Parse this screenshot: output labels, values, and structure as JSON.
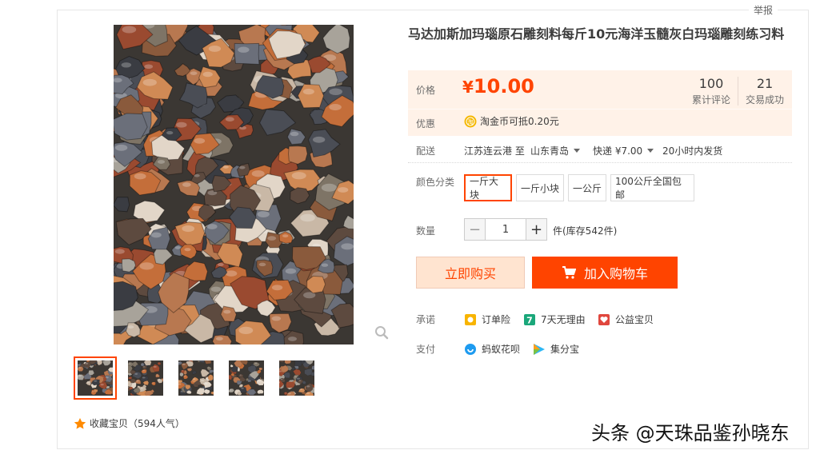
{
  "report": "举报",
  "title": "马达加斯加玛瑙原石雕刻料每斤10元海洋玉髓灰白玛瑙雕刻练习料",
  "price": {
    "label": "价格",
    "yen": "¥",
    "value": "10.00",
    "reviews_count": "100",
    "reviews_label": "累计评论",
    "trades_count": "21",
    "trades_label": "交易成功"
  },
  "promo": {
    "label": "优惠",
    "text": "淘金币可抵0.20元"
  },
  "shipping": {
    "label": "配送",
    "from": "江苏连云港 至",
    "to": "山东青岛",
    "method": "快递 ¥7.00",
    "time": "20小时内发货"
  },
  "variant": {
    "label": "颜色分类",
    "options": [
      "一斤大块",
      "一斤小块",
      "一公斤",
      "100公斤全国包邮"
    ],
    "selected_index": 0
  },
  "quantity": {
    "label": "数量",
    "value": "1",
    "stock": "件(库存542件)"
  },
  "actions": {
    "buy_now": "立即购买",
    "add_cart": "加入购物车"
  },
  "promise": {
    "label": "承诺",
    "items": [
      "订单险",
      "7天无理由",
      "公益宝贝"
    ]
  },
  "payment": {
    "label": "支付",
    "items": [
      "蚂蚁花呗",
      "集分宝"
    ]
  },
  "favorite": "收藏宝贝（594人气）",
  "watermark": "头条 @天珠品鉴孙晓东",
  "colors": {
    "accent": "#ff4400",
    "price_bg": "#fff2e8"
  }
}
